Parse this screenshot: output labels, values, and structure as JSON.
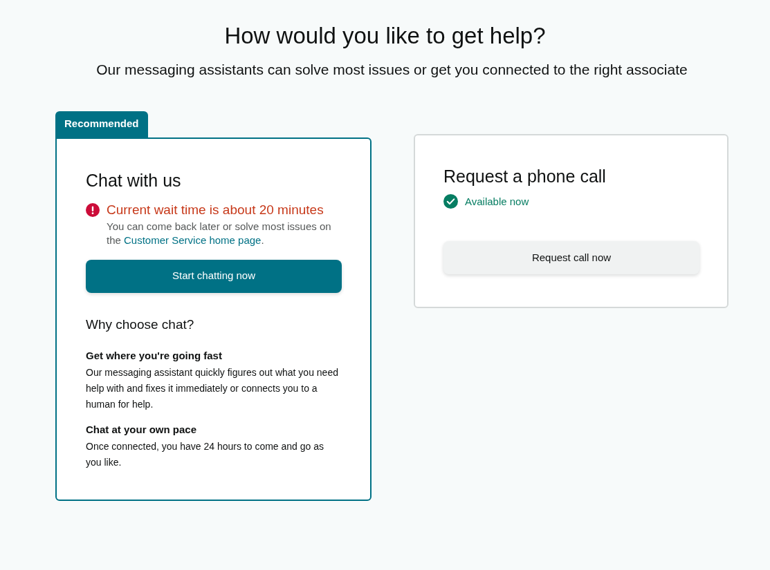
{
  "title": "How would you like to get help?",
  "subtitle": "Our messaging assistants can solve most issues or get you connected to the right associate",
  "options": [
    {
      "kind": "chat",
      "badge": "Recommended",
      "title": "Chat with us",
      "status": {
        "kind": "warning",
        "text": "Current wait time is about 20 minutes"
      },
      "note": {
        "before": "You can come back later or solve most issues on the ",
        "link": "Customer Service home page",
        "after": "."
      },
      "button": {
        "label": "Start chatting now",
        "primary": true
      },
      "why": {
        "heading": "Why choose chat?",
        "points": [
          {
            "title": "Get where you're going fast",
            "text": "Our messaging assistant quickly figures out what you need help with and fixes it immediately or connects you to a human for help."
          },
          {
            "title": "Chat at your own pace",
            "text": "Once connected, you have 24 hours to come and go as you like."
          }
        ]
      }
    },
    {
      "kind": "phone",
      "title": "Request a phone call",
      "status": {
        "kind": "available",
        "text": "Available now"
      },
      "button": {
        "label": "Request call now",
        "primary": false
      }
    }
  ]
}
